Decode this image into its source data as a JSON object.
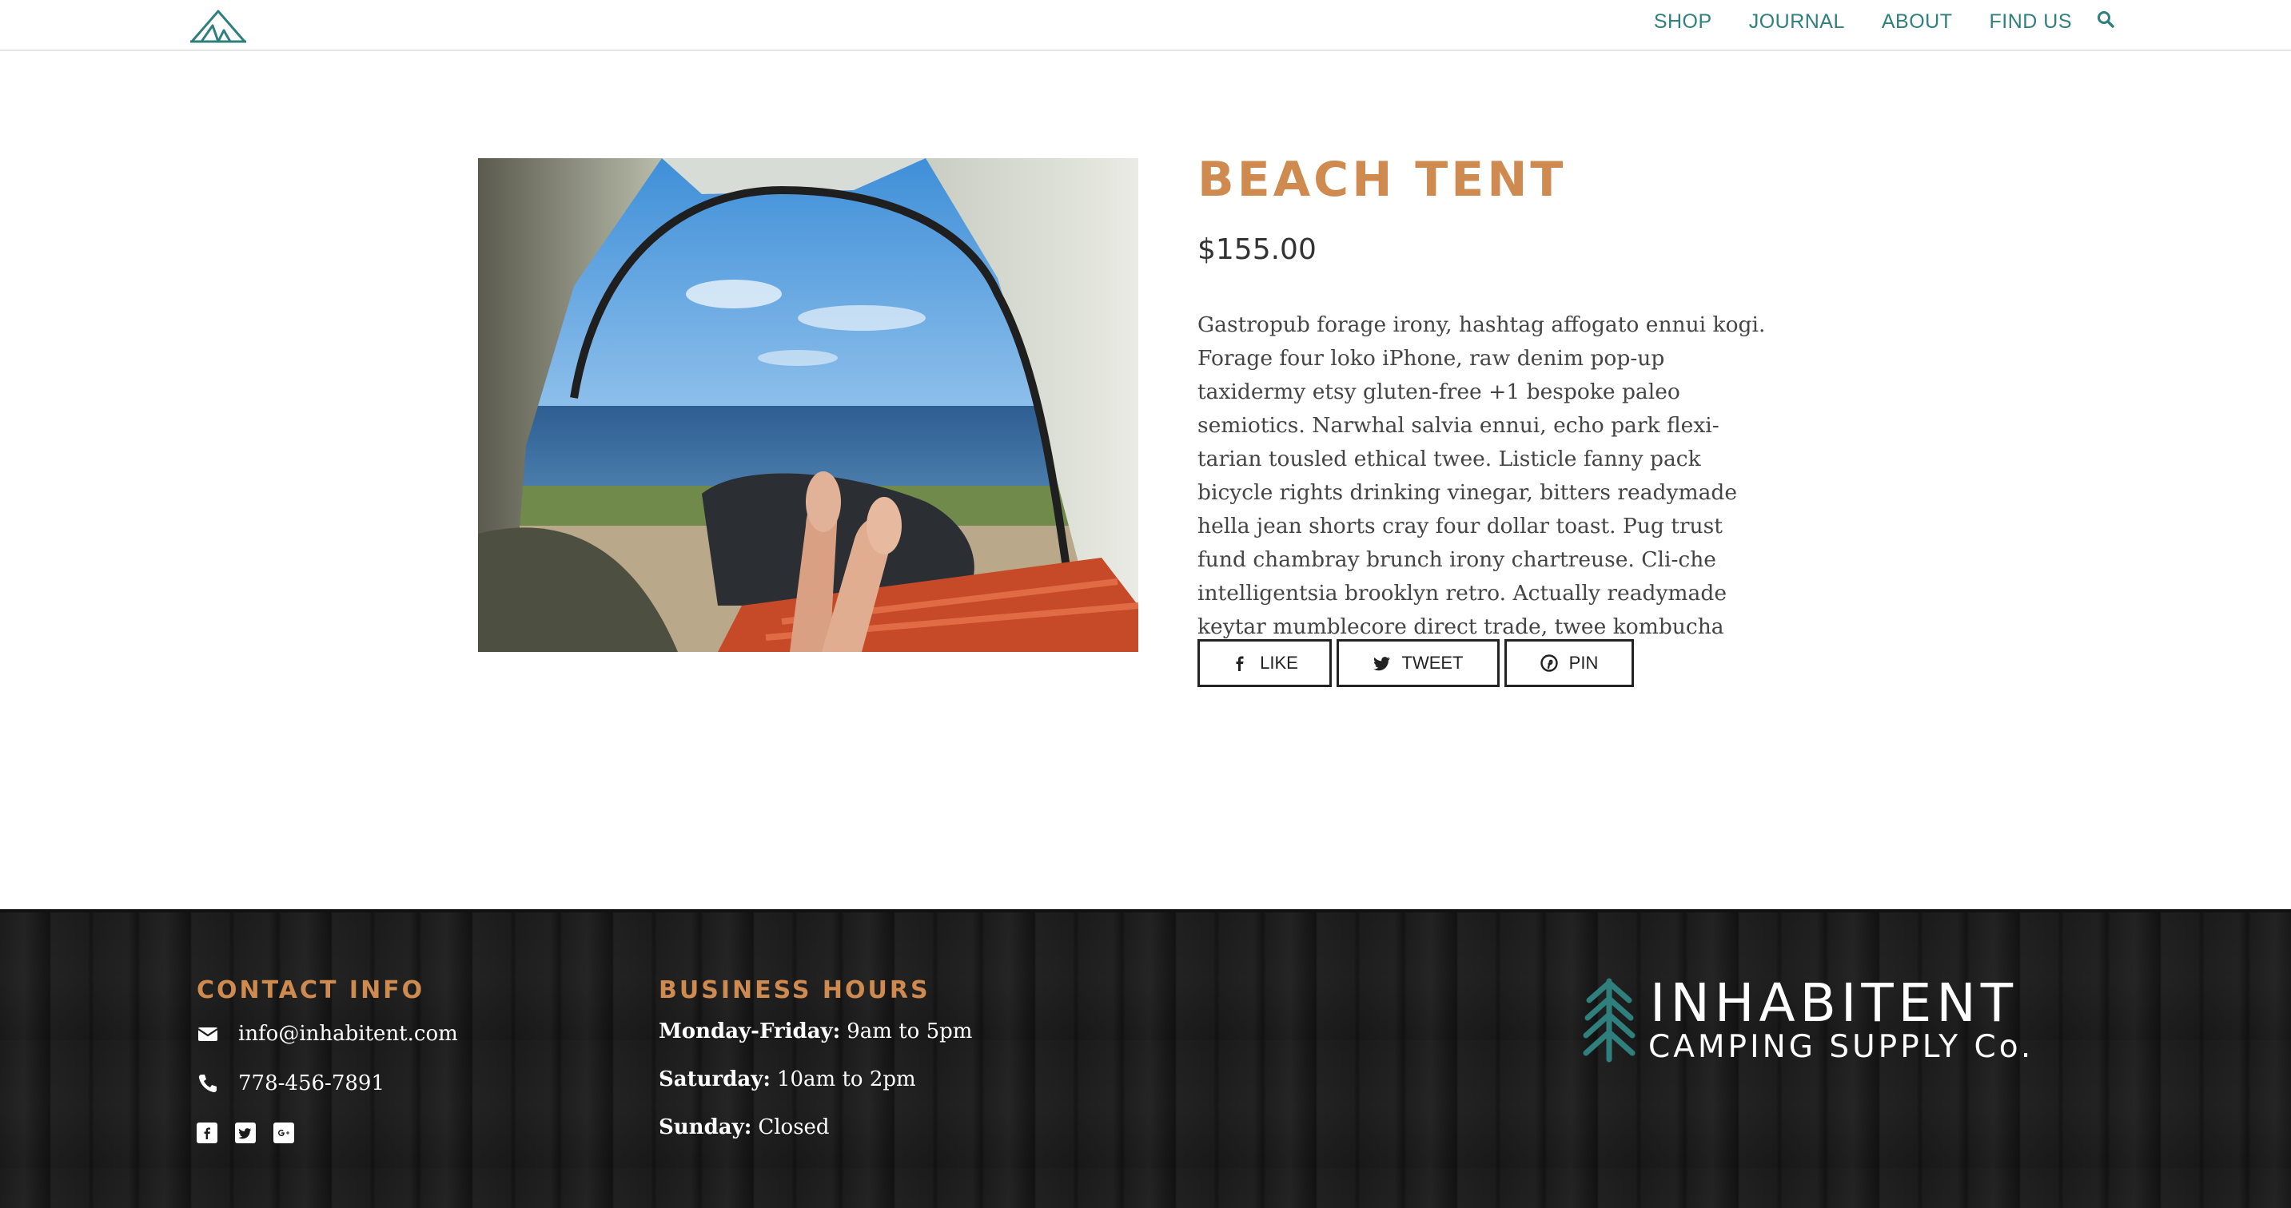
{
  "nav": {
    "items": [
      {
        "label": "SHOP"
      },
      {
        "label": "JOURNAL"
      },
      {
        "label": "ABOUT"
      },
      {
        "label": "FIND US"
      }
    ],
    "search_icon": "search-icon"
  },
  "product": {
    "title": "BEACH TENT",
    "price": "$155.00",
    "description": "Gastropub forage irony, hashtag affogato ennui kogi. Forage four loko iPhone, raw denim pop-up taxidermy etsy gluten-free +1 bespoke paleo semiotics. Narwhal salvia ennui, echo park flexi-tarian tousled ethical twee. Listicle fanny pack bicycle rights drinking vinegar, bitters readymade hella jean shorts cray four dollar toast. Pug trust fund chambray brunch irony chartreuse. Cli-che intelligentsia brooklyn retro. Actually readymade keytar mumblecore direct trade, twee kombucha iPhone.",
    "share": {
      "like": "LIKE",
      "tweet": "TWEET",
      "pin": "PIN"
    }
  },
  "footer": {
    "contact": {
      "heading": "CONTACT INFO",
      "email": "info@inhabitent.com",
      "phone": "778-456-7891"
    },
    "hours": {
      "heading": "BUSINESS HOURS",
      "rows": [
        {
          "day": "Monday-Friday:",
          "time": "9am to 5pm"
        },
        {
          "day": "Saturday:",
          "time": "10am to 2pm"
        },
        {
          "day": "Sunday:",
          "time": "Closed"
        }
      ]
    },
    "brand": {
      "name": "INHABITENT",
      "tagline": "CAMPING SUPPLY Co."
    }
  },
  "colors": {
    "accent": "#cf8a4f",
    "teal": "#2f7f7c",
    "footer_bg": "#1b1b1b"
  }
}
